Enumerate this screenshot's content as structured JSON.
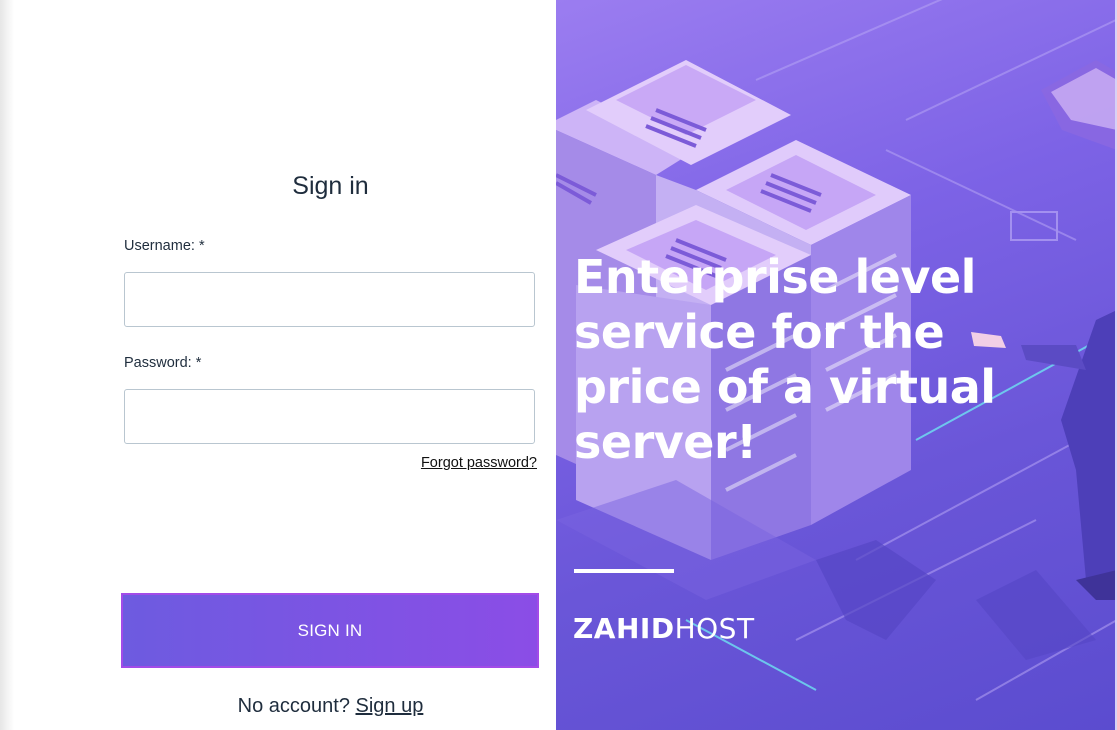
{
  "form": {
    "title": "Sign in",
    "username_label": "Username: *",
    "password_label": "Password: *",
    "username_value": "",
    "password_value": "",
    "forgot_password": "Forgot password?",
    "submit_label": "SIGN IN",
    "no_account_text": "No account?",
    "signup_link": "Sign up"
  },
  "promo": {
    "headline_lines": [
      "Enterprise level",
      "service for the",
      "price of a virtual",
      "server!"
    ],
    "brand_bold": "ZAHID",
    "brand_light": "HOST"
  },
  "colors": {
    "button_gradient_start": "#6d5be0",
    "button_gradient_end": "#8b4de6",
    "panel_purple": "#7d63e6",
    "text_dark": "#1f2d3d"
  },
  "icons": {
    "illustration": "server-rack-illustration"
  }
}
